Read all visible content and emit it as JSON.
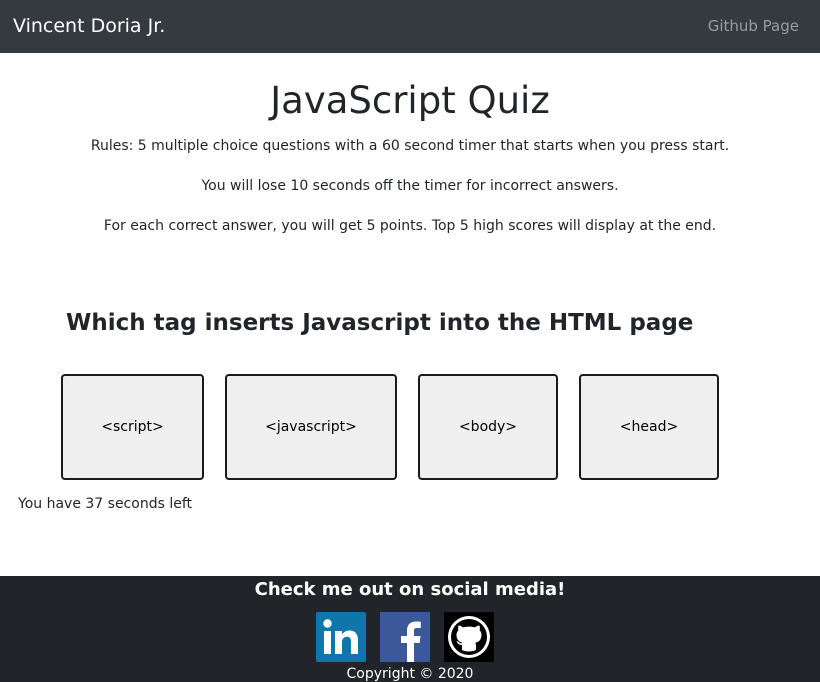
{
  "navbar": {
    "brand": "Vincent Doria Jr.",
    "link": "Github Page"
  },
  "main": {
    "title": "JavaScript Quiz",
    "rules": [
      "Rules: 5 multiple choice questions with a 60 second timer that starts when you press start.",
      "You will lose 10 seconds off the timer for incorrect answers.",
      "For each correct answer, you will get 5 points. Top 5 high scores will display at the end."
    ],
    "question": "Which tag inserts Javascript into the HTML page",
    "answers": [
      "<script>",
      "<javascript>",
      "<body>",
      "<head>"
    ],
    "timer": "You have 37 seconds left"
  },
  "footer": {
    "heading": "Check me out on social media!",
    "social": [
      "linkedin-icon",
      "facebook-icon",
      "github-icon"
    ],
    "copyright": "Copyright © 2020"
  },
  "colors": {
    "navbar_bg": "#343a40",
    "footer_bg": "#212529",
    "button_bg": "#efefef",
    "linkedin": "#0e76a8",
    "facebook": "#3b5998"
  }
}
